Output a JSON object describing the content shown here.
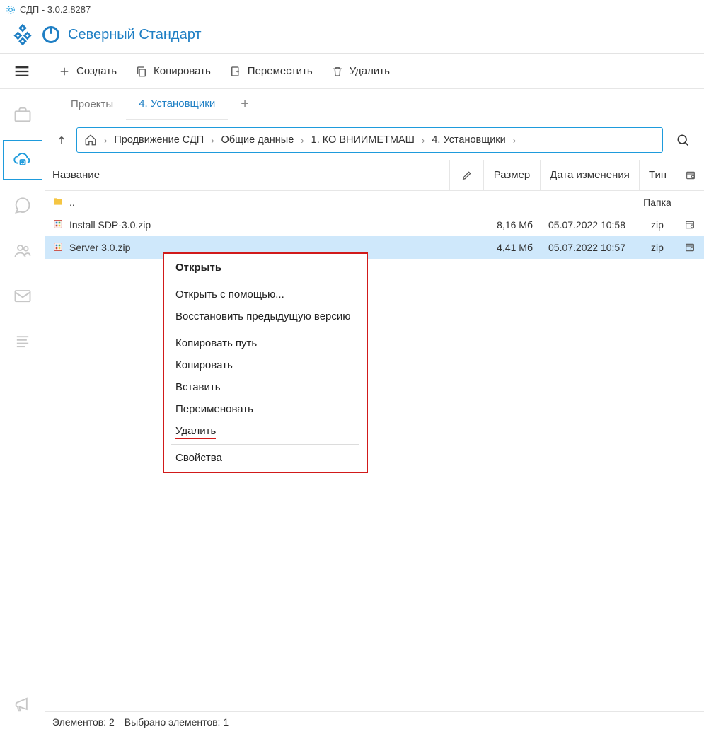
{
  "title": "СДП - 3.0.2.8287",
  "brand": "Северный Стандарт",
  "toolbar": {
    "create": "Создать",
    "copy": "Копировать",
    "move": "Переместить",
    "delete": "Удалить"
  },
  "tabs": {
    "items": [
      "Проекты",
      "4. Установщики"
    ],
    "active": 1
  },
  "breadcrumb": [
    "Продвижение СДП",
    "Общие данные",
    "1. КО ВНИИМЕТМАШ",
    "4. Установщики"
  ],
  "columns": {
    "name": "Название",
    "size": "Размер",
    "date": "Дата изменения",
    "type": "Тип"
  },
  "rows": [
    {
      "name": "..",
      "size": "",
      "date": "",
      "type": "Папка",
      "kind": "up",
      "hasCal": false
    },
    {
      "name": "Install SDP-3.0.zip",
      "size": "8,16 Мб",
      "date": "05.07.2022 10:58",
      "type": "zip",
      "kind": "archive",
      "hasCal": true
    },
    {
      "name": "Server 3.0.zip",
      "size": "4,41 Мб",
      "date": "05.07.2022 10:57",
      "type": "zip",
      "kind": "archive",
      "hasCal": true,
      "selected": true
    }
  ],
  "context_menu": {
    "items": [
      "Открыть",
      "Открыть с помощью...",
      "Восстановить предыдущую версию",
      "Копировать путь",
      "Копировать",
      "Вставить",
      "Переименовать",
      "Удалить",
      "Свойства"
    ],
    "separators_after": [
      0,
      2,
      7
    ],
    "highlighted": 7
  },
  "status": {
    "elements": "Элементов: 2",
    "selected": "Выбрано элементов: 1"
  }
}
